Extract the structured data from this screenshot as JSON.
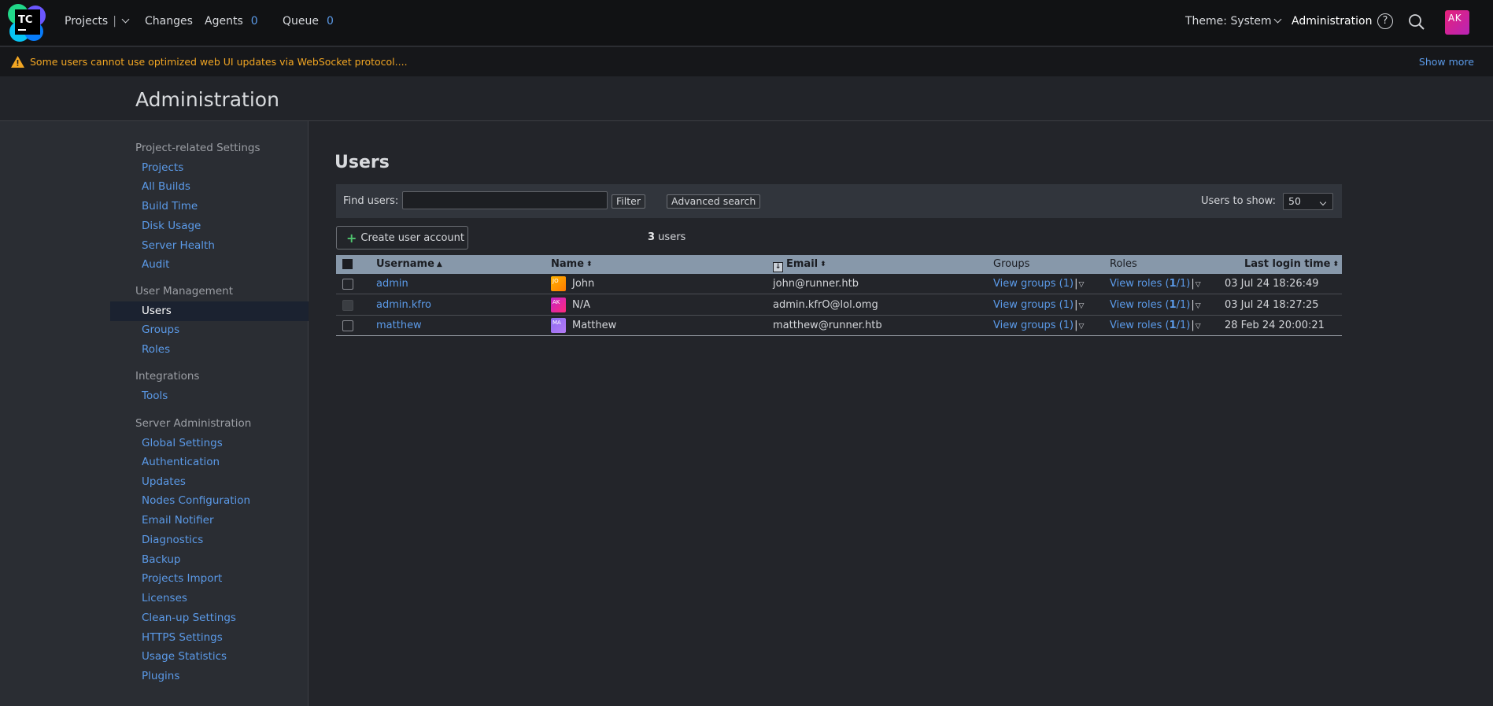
{
  "header": {
    "logo_text": "TC",
    "projects_label": "Projects",
    "changes_label": "Changes",
    "agents_label": "Agents",
    "agents_count": "0",
    "queue_label": "Queue",
    "queue_count": "0",
    "theme_label": "Theme: System",
    "admin_label": "Administration",
    "help_glyph": "?",
    "avatar_initials": "AK"
  },
  "warning": {
    "text": "Some users cannot use optimized web UI updates via WebSocket protocol....",
    "show_more": "Show more"
  },
  "page_title": "Administration",
  "sidebar": {
    "sections": [
      {
        "title": "Project-related Settings",
        "items": [
          "Projects",
          "All Builds",
          "Build Time",
          "Disk Usage",
          "Server Health",
          "Audit"
        ]
      },
      {
        "title": "User Management",
        "items": [
          "Users",
          "Groups",
          "Roles"
        ]
      },
      {
        "title": "Integrations",
        "items": [
          "Tools"
        ]
      },
      {
        "title": "Server Administration",
        "items": [
          "Global Settings",
          "Authentication",
          "Updates",
          "Nodes Configuration",
          "Email Notifier",
          "Diagnostics",
          "Backup",
          "Projects Import",
          "Licenses",
          "Clean-up Settings",
          "HTTPS Settings",
          "Usage Statistics",
          "Plugins"
        ]
      }
    ],
    "active_item": "Users"
  },
  "users": {
    "title": "Users",
    "find_label": "Find users:",
    "find_value": "",
    "filter_button": "Filter",
    "advanced_button": "Advanced search",
    "show_label": "Users to show:",
    "show_value": "50",
    "create_button": "Create user account",
    "count_number": "3",
    "count_suffix": " users",
    "columns": {
      "username": "Username",
      "name": "Name",
      "email": "Email",
      "groups": "Groups",
      "roles": "Roles",
      "last_login": "Last login time"
    },
    "rows": [
      {
        "username": "admin",
        "avatar": "JO",
        "name": "John",
        "email": "john@runner.htb",
        "groups": "View groups (1)",
        "roles_prefix": "View roles (",
        "roles_count": "1",
        "roles_suffix": "/1)",
        "last_login": "03 Jul 24 18:26:49"
      },
      {
        "username": "admin.kfro",
        "avatar": "AK",
        "name": "N/A",
        "email": "admin.kfrO@lol.omg",
        "groups": "View groups (1)",
        "roles_prefix": "View roles (",
        "roles_count": "1",
        "roles_suffix": "/1)",
        "last_login": "03 Jul 24 18:27:25"
      },
      {
        "username": "matthew",
        "avatar": "MA",
        "name": "Matthew",
        "email": "matthew@runner.htb",
        "groups": "View groups (1)",
        "roles_prefix": "View roles (",
        "roles_count": "1",
        "roles_suffix": "/1)",
        "last_login": "28 Feb 24 20:00:21"
      }
    ]
  },
  "colors": {
    "accent_link": "#5b9ae8",
    "warning": "#f2a623",
    "table_header": "#8798aa"
  }
}
